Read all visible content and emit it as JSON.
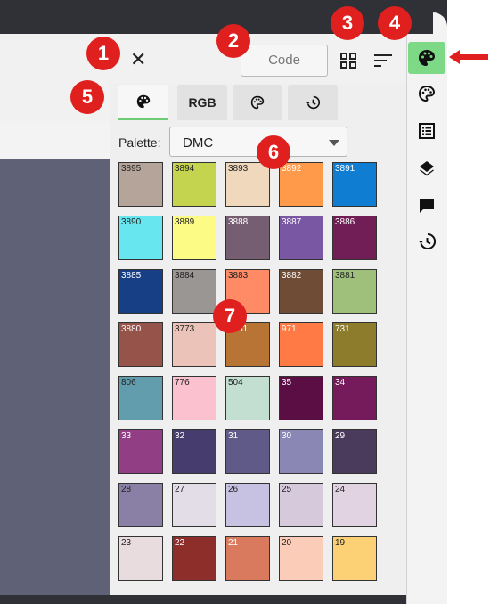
{
  "header": {
    "code_label": "Code"
  },
  "tabs": [
    {
      "icon": "palette-icon",
      "active": true,
      "label": ""
    },
    {
      "label": "RGB"
    },
    {
      "icon": "palette-outline-icon",
      "label": ""
    },
    {
      "icon": "history-icon",
      "label": ""
    }
  ],
  "palette": {
    "label": "Palette:",
    "selected": "DMC"
  },
  "swatches": [
    {
      "code": "3895",
      "color": "#b4a49a",
      "text": "#222"
    },
    {
      "code": "3894",
      "color": "#c5d44e",
      "text": "#222"
    },
    {
      "code": "3893",
      "color": "#efd8bc",
      "text": "#222"
    },
    {
      "code": "3892",
      "color": "#ff9a4a",
      "text": "#fff"
    },
    {
      "code": "3891",
      "color": "#0f7ed2",
      "text": "#fff"
    },
    {
      "code": "3890",
      "color": "#67e6f0",
      "text": "#222"
    },
    {
      "code": "3889",
      "color": "#fbfb86",
      "text": "#222"
    },
    {
      "code": "3888",
      "color": "#765e72",
      "text": "#fff"
    },
    {
      "code": "3887",
      "color": "#7957a3",
      "text": "#fff"
    },
    {
      "code": "3886",
      "color": "#721e56",
      "text": "#fff"
    },
    {
      "code": "3885",
      "color": "#173f85",
      "text": "#fff"
    },
    {
      "code": "3884",
      "color": "#9a9694",
      "text": "#222"
    },
    {
      "code": "3883",
      "color": "#ff8b66",
      "text": "#222"
    },
    {
      "code": "3882",
      "color": "#6f4c36",
      "text": "#fff"
    },
    {
      "code": "3881",
      "color": "#9fc07b",
      "text": "#222"
    },
    {
      "code": "3880",
      "color": "#965349",
      "text": "#fff"
    },
    {
      "code": "3773",
      "color": "#ecc3b8",
      "text": "#222"
    },
    {
      "code": "3781",
      "color": "#b87434",
      "text": "#fff"
    },
    {
      "code": "971",
      "color": "#ff7a44",
      "text": "#fff"
    },
    {
      "code": "731",
      "color": "#8c7c2b",
      "text": "#fff"
    },
    {
      "code": "806",
      "color": "#629dae",
      "text": "#222"
    },
    {
      "code": "776",
      "color": "#fbc1cf",
      "text": "#222"
    },
    {
      "code": "504",
      "color": "#c2dfd1",
      "text": "#222"
    },
    {
      "code": "35",
      "color": "#5a0e44",
      "text": "#fff"
    },
    {
      "code": "34",
      "color": "#751a5a",
      "text": "#fff"
    },
    {
      "code": "33",
      "color": "#913e84",
      "text": "#fff"
    },
    {
      "code": "32",
      "color": "#473c6e",
      "text": "#fff"
    },
    {
      "code": "31",
      "color": "#5f5a87",
      "text": "#fff"
    },
    {
      "code": "30",
      "color": "#8a87b4",
      "text": "#fff"
    },
    {
      "code": "29",
      "color": "#4a3b5d",
      "text": "#fff"
    },
    {
      "code": "28",
      "color": "#8a7fa4",
      "text": "#222"
    },
    {
      "code": "27",
      "color": "#e2dde6",
      "text": "#222"
    },
    {
      "code": "26",
      "color": "#c7c2e2",
      "text": "#222"
    },
    {
      "code": "25",
      "color": "#d6c9db",
      "text": "#222"
    },
    {
      "code": "24",
      "color": "#e2d3e3",
      "text": "#222"
    },
    {
      "code": "23",
      "color": "#e9dcdf",
      "text": "#222"
    },
    {
      "code": "22",
      "color": "#8d2e2b",
      "text": "#fff"
    },
    {
      "code": "21",
      "color": "#d97a5f",
      "text": "#fff"
    },
    {
      "code": "20",
      "color": "#fbccb7",
      "text": "#222"
    },
    {
      "code": "19",
      "color": "#fcd176",
      "text": "#222"
    }
  ],
  "badges": [
    "1",
    "2",
    "3",
    "4",
    "5",
    "6",
    "7"
  ],
  "colors": {
    "accent_green": "#7ed987",
    "badge_red": "#e0201f",
    "canvas": "#5f6176"
  },
  "right_rail": [
    "palette-icon",
    "palette-outline-icon",
    "list-icon",
    "layers-icon",
    "comment-icon",
    "history-icon"
  ]
}
